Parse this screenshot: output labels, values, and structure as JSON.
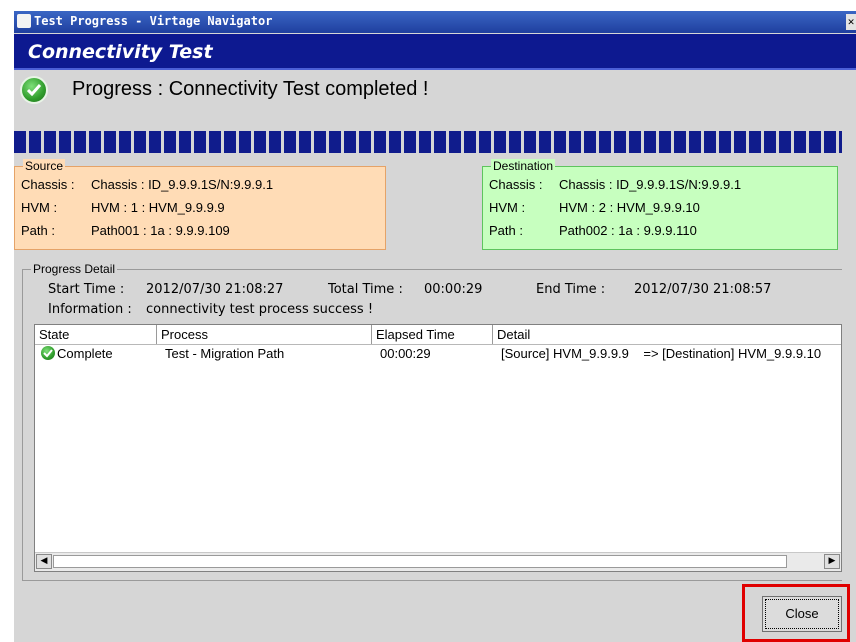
{
  "window": {
    "title": "Test Progress - Virtage Navigator",
    "banner_title": "Connectivity Test"
  },
  "status": {
    "message": "Progress : Connectivity Test completed !",
    "icon": "check-circle-icon",
    "progress_percent": 100
  },
  "source": {
    "legend": "Source",
    "rows": [
      {
        "label": "Chassis :",
        "value": "Chassis : ID_9.9.9.1S/N:9.9.9.1"
      },
      {
        "label": "HVM :",
        "value": "HVM : 1 : HVM_9.9.9.9"
      },
      {
        "label": "Path :",
        "value": "Path001 : 1a : 9.9.9.109"
      }
    ]
  },
  "destination": {
    "legend": "Destination",
    "rows": [
      {
        "label": "Chassis :",
        "value": "Chassis : ID_9.9.9.1S/N:9.9.9.1"
      },
      {
        "label": "HVM :",
        "value": "HVM : 2 : HVM_9.9.9.10"
      },
      {
        "label": "Path :",
        "value": "Path002 : 1a : 9.9.9.110"
      }
    ]
  },
  "progress_detail": {
    "legend": "Progress Detail",
    "start_label": "Start Time :",
    "start_value": "2012/07/30 21:08:27",
    "total_label": "Total Time :",
    "total_value": "00:00:29",
    "end_label": "End Time :",
    "end_value": "2012/07/30 21:08:57",
    "info_label": "Information :",
    "info_value": "connectivity test process success !"
  },
  "table": {
    "columns": [
      "State",
      "Process",
      "Elapsed Time",
      "Detail"
    ],
    "rows": [
      {
        "state": "Complete",
        "process": "Test - Migration Path",
        "elapsed": "00:00:29",
        "detail": "[Source] HVM_9.9.9.9    => [Destination] HVM_9.9.9.10"
      }
    ]
  },
  "buttons": {
    "close_label": "Close"
  },
  "colors": {
    "banner": "#0d1990",
    "progress": "#101c8c",
    "source_bg": "#ffdcb6",
    "dest_bg": "#c7ffbf",
    "highlight": "#e00000"
  }
}
